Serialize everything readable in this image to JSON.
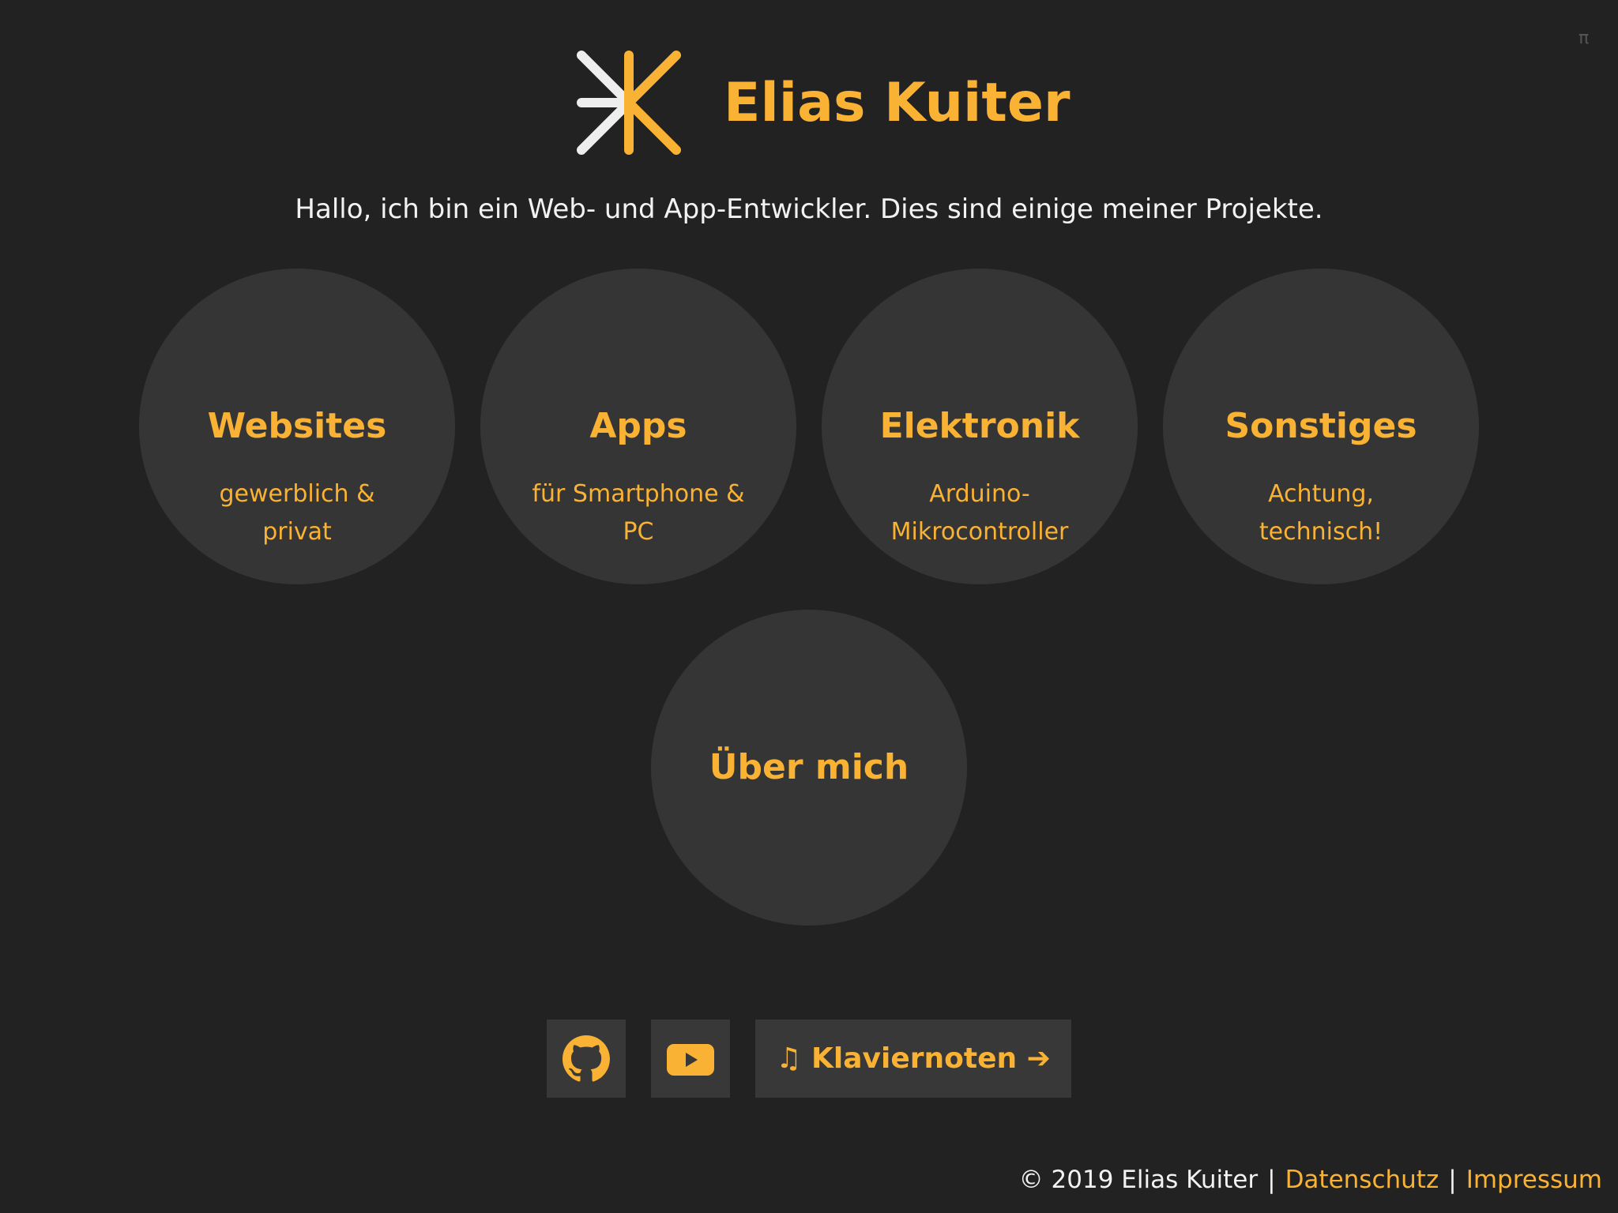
{
  "header": {
    "pi_link": "π",
    "title": "Elias Kuiter",
    "intro": "Hallo, ich bin ein Web- und App-Entwickler. Dies sind einige meiner Projekte."
  },
  "categories": [
    {
      "title": "Websites",
      "subtitle": "gewerblich & privat"
    },
    {
      "title": "Apps",
      "subtitle": "für Smartphone & PC"
    },
    {
      "title": "Elektronik",
      "subtitle": "Arduino-Mikrocontroller"
    },
    {
      "title": "Sonstiges",
      "subtitle": "Achtung, technisch!"
    },
    {
      "title": "Über mich"
    }
  ],
  "links": {
    "github_icon": "github-icon",
    "youtube_icon": "youtube-icon",
    "notes_label": "♫ Klaviernoten ➔"
  },
  "footer": {
    "copyright": "© 2019 Elias Kuiter",
    "separator": "|",
    "privacy": "Datenschutz",
    "imprint": "Impressum"
  },
  "colors": {
    "background": "#222222",
    "accent": "#f9b233",
    "circle": "#353535",
    "text": "#f2f2f2"
  }
}
